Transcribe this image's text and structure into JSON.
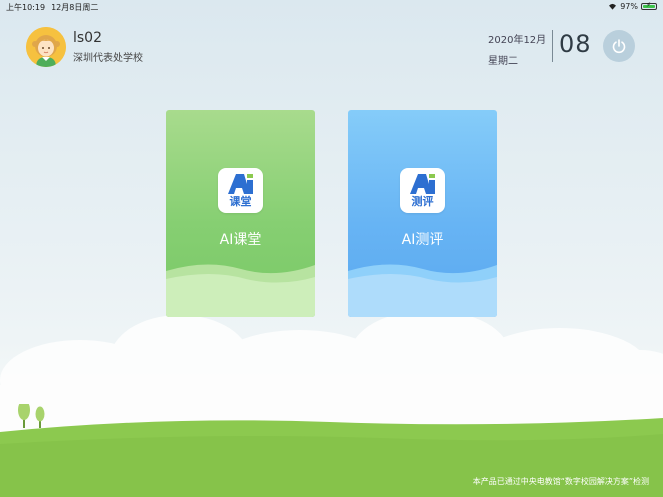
{
  "status_bar": {
    "time": "上午10:19",
    "date": "12月8日周二",
    "battery_percent": "97%",
    "battery_level": 0.97
  },
  "user": {
    "name": "ls02",
    "school": "深圳代表处学校"
  },
  "datetime": {
    "year_month": "2020年12月",
    "weekday": "星期二",
    "day": "08"
  },
  "cards": [
    {
      "icon_text": "课堂",
      "title": "AI课堂",
      "color": "#86cf72"
    },
    {
      "icon_text": "测评",
      "title": "AI测评",
      "color": "#67b4f4"
    }
  ],
  "footer": {
    "note": "本产品已通过中央电教馆“数字校园解决方案”检测"
  },
  "icons": {
    "power": "power-icon",
    "wifi": "wifi-icon",
    "battery": "battery-icon",
    "app": "ai-logo-icon"
  }
}
